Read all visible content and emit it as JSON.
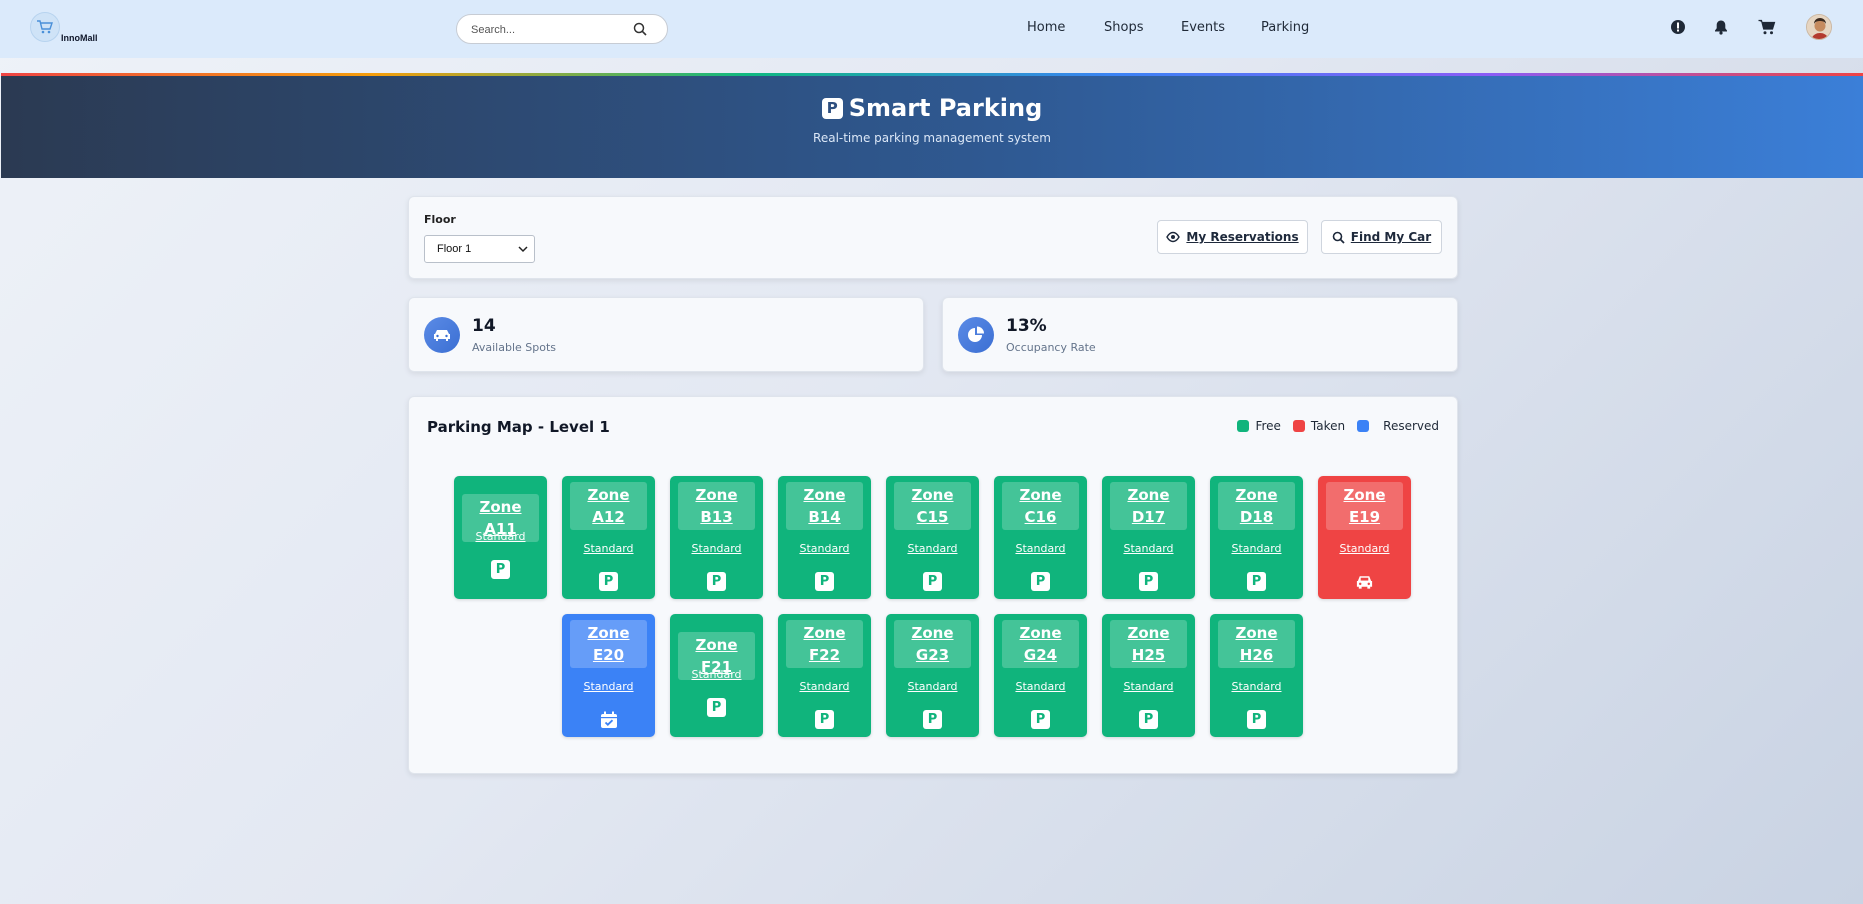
{
  "navbar": {
    "logo_text": "InnoMall",
    "search_placeholder": "Search...",
    "links": [
      "Home",
      "Shops",
      "Events",
      "Parking"
    ]
  },
  "hero": {
    "badge": "P",
    "title": "Smart Parking",
    "subtitle": "Real-time parking management system"
  },
  "controls": {
    "floor_label": "Floor",
    "floor_value": "Floor 1",
    "reservations_button": "My Reservations",
    "find_car_button": "Find My Car"
  },
  "stats": {
    "available_value": "14",
    "available_label": "Available Spots",
    "occupancy_value": "13%",
    "occupancy_label": "Occupancy Rate"
  },
  "map": {
    "title": "Parking Map - Level 1",
    "legend": {
      "free": "Free",
      "taken": "Taken",
      "reserved": "Reserved"
    },
    "colors": {
      "free": "#10b47c",
      "taken": "#ef4444",
      "reserved": "#3b82f6"
    },
    "spots": [
      {
        "line1": "Zone A11",
        "line2": "",
        "type": "Standard",
        "status": "free"
      },
      {
        "line1": "Zone",
        "line2": "A12",
        "type": "Standard",
        "status": "free"
      },
      {
        "line1": "Zone",
        "line2": "B13",
        "type": "Standard",
        "status": "free"
      },
      {
        "line1": "Zone",
        "line2": "B14",
        "type": "Standard",
        "status": "free"
      },
      {
        "line1": "Zone",
        "line2": "C15",
        "type": "Standard",
        "status": "free"
      },
      {
        "line1": "Zone",
        "line2": "C16",
        "type": "Standard",
        "status": "free"
      },
      {
        "line1": "Zone",
        "line2": "D17",
        "type": "Standard",
        "status": "free"
      },
      {
        "line1": "Zone",
        "line2": "D18",
        "type": "Standard",
        "status": "free"
      },
      {
        "line1": "Zone",
        "line2": "E19",
        "type": "Standard",
        "status": "taken"
      },
      {
        "line1": "Zone",
        "line2": "E20",
        "type": "Standard",
        "status": "reserved"
      },
      {
        "line1": "Zone F21",
        "line2": "",
        "type": "Standard",
        "status": "free"
      },
      {
        "line1": "Zone",
        "line2": "F22",
        "type": "Standard",
        "status": "free"
      },
      {
        "line1": "Zone",
        "line2": "G23",
        "type": "Standard",
        "status": "free"
      },
      {
        "line1": "Zone",
        "line2": "G24",
        "type": "Standard",
        "status": "free"
      },
      {
        "line1": "Zone",
        "line2": "H25",
        "type": "Standard",
        "status": "free"
      },
      {
        "line1": "Zone",
        "line2": "H26",
        "type": "Standard",
        "status": "free"
      }
    ],
    "free_icon_glyph": "P"
  }
}
